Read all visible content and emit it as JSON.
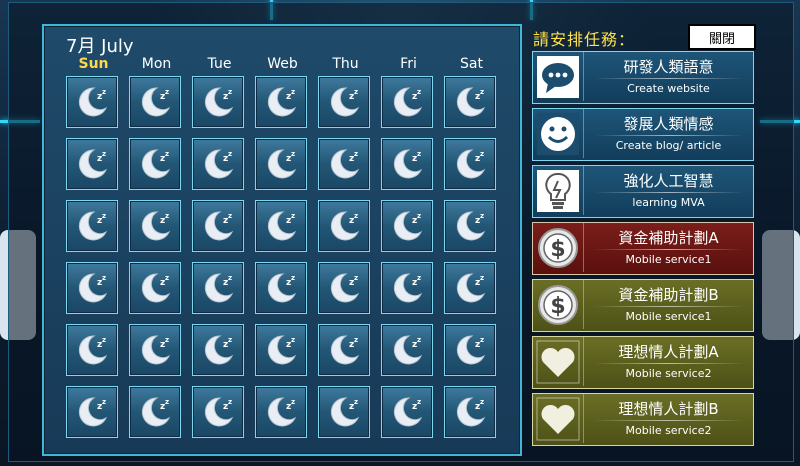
{
  "calendar": {
    "title": "7月 July",
    "weekdays": [
      "Sun",
      "Mon",
      "Tue",
      "Web",
      "Thu",
      "Fri",
      "Sat"
    ],
    "rows": 6,
    "cell_icon": "moon-sleep-icon"
  },
  "sidebar": {
    "title": "請安排任務：",
    "close_label": "關閉",
    "tasks": [
      {
        "title": "研發人類語意",
        "subtitle": "Create website",
        "icon": "speech-bubble-icon",
        "color": "blue"
      },
      {
        "title": "發展人類情感",
        "subtitle": "Create blog/ article",
        "icon": "smiley-icon",
        "color": "blue"
      },
      {
        "title": "強化人工智慧",
        "subtitle": "learning MVA",
        "icon": "lightbulb-icon",
        "color": "blue"
      },
      {
        "title": "資金補助計劃A",
        "subtitle": "Mobile service1",
        "icon": "dollar-coin-icon",
        "color": "red"
      },
      {
        "title": "資金補助計劃B",
        "subtitle": "Mobile service1",
        "icon": "dollar-coin-icon",
        "color": "olive"
      },
      {
        "title": "理想情人計劃A",
        "subtitle": "Mobile service2",
        "icon": "heart-icon",
        "color": "olive"
      },
      {
        "title": "理想情人計劃B",
        "subtitle": "Mobile service2",
        "icon": "heart-icon",
        "color": "olive"
      }
    ]
  },
  "colors": {
    "accent": "#3fb7d9",
    "sunday": "#ffd54a",
    "title": "#ffe24a"
  }
}
